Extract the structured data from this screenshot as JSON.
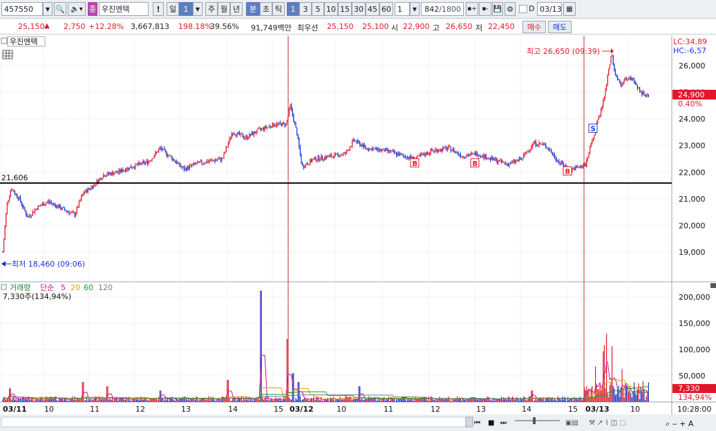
{
  "toolbar": {
    "code": "457550",
    "search_icon": "search-icon",
    "sound_icon": "speaker-icon",
    "kind_badge": "종",
    "stock_name": "우진엔텍",
    "alert": "!",
    "period_day": "일",
    "period_day_value": "1",
    "period_week": "주",
    "period_month": "월",
    "period_year": "년",
    "period_minute": "분",
    "period_second": "초",
    "period_tick": "틱",
    "minute_options": [
      "1",
      "3",
      "5",
      "10",
      "15",
      "30",
      "45",
      "60"
    ],
    "count_value": "1",
    "bar_count": "842",
    "bar_total": "/1800",
    "date_value": "03/13"
  },
  "quote": {
    "price": "25,150",
    "arrow": "▲",
    "change": "2,750",
    "change_pct": "+12.28%",
    "volume": "3,667,813",
    "vol_ratio": "198.18%",
    "turnover": "39.56%",
    "amount": "91,749백만",
    "best_label": "최우선",
    "ask": "25,150",
    "bid": "25,100",
    "open_label": "시",
    "open": "22,900",
    "high_label": "고",
    "high": "26,650",
    "low_label": "저",
    "low": "22,450",
    "buy_button": "매수",
    "sell_button": "매도"
  },
  "price_panel": {
    "title": "우진엔텍",
    "line_value": "21,606",
    "high_annotation": "최고 26,650 (09:39)",
    "low_annotation": "최저 18,460 (09:06)",
    "lc": "LC:34,89",
    "hc": "HC:-6,57",
    "current": "24,900",
    "current_pct": "0.40%",
    "yticks": [
      "26,000",
      "25,000",
      "24,000",
      "23,000",
      "22,000",
      "21,000",
      "20,000",
      "19,000"
    ],
    "signals": [
      "B",
      "B",
      "B",
      "S"
    ]
  },
  "volume_panel": {
    "title": "거래량",
    "ma_label": "단순",
    "ma_periods": [
      "5",
      "20",
      "60",
      "120"
    ],
    "current": "7,330주(134,94%)",
    "yticks": [
      "200,000",
      "150,000",
      "100,000",
      "50,000"
    ],
    "last_value": "7,330",
    "last_pct": "134,94%"
  },
  "xaxis": {
    "labels": [
      "03/11",
      "10",
      "11",
      "12",
      "13",
      "14",
      "15",
      "03/12",
      "10",
      "11",
      "12",
      "13",
      "14",
      "15",
      "03/13",
      "10"
    ],
    "time": "10:28:00"
  },
  "colors": {
    "up": "#e0192a",
    "down": "#1537d4",
    "ma5": "#c0149a",
    "ma20": "#e0a000",
    "ma60": "#1a9a30",
    "ma120": "#777777",
    "selected": "#5d7ec1"
  }
}
